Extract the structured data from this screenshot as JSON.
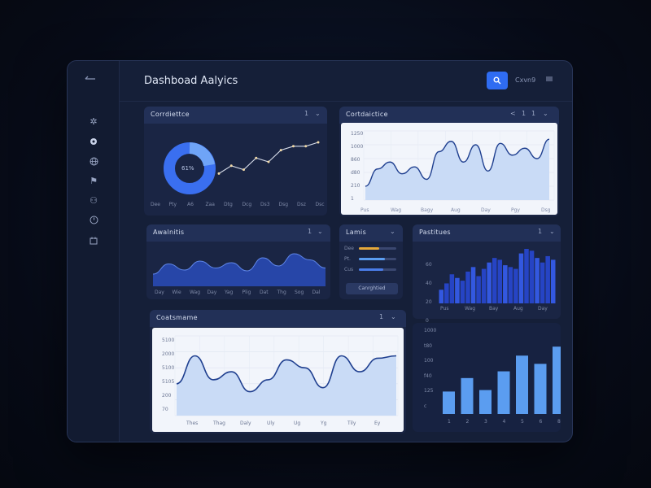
{
  "header": {
    "title": "Dashboad Aalyics",
    "user_label": "Cxvn9",
    "search_icon": "search-icon",
    "menu_icon": "menu-icon",
    "back_icon": "back-arrow-icon"
  },
  "sidebar": {
    "icons": [
      "settings-icon",
      "circle-icon",
      "globe-icon",
      "flag-icon",
      "users-icon",
      "clock-icon",
      "calendar-icon"
    ]
  },
  "cards": {
    "card1": {
      "title": "Corrdiettce",
      "donut_label": "61%",
      "ctrl_num": "1",
      "x_ticks": [
        "Dee",
        "Pty",
        "A6",
        "Zaa",
        "Dtg",
        "Dcg",
        "Ds3",
        "Dsg",
        "Dsz",
        "Dsc"
      ]
    },
    "card2": {
      "title": "Cortdaictice",
      "ctrl_a": "<",
      "ctrl_b": "1",
      "ctrl_c": "1",
      "y_ticks": [
        "1250",
        "1000",
        "860",
        "d80",
        "210",
        "1"
      ],
      "x_ticks": [
        "Pus",
        "Wag",
        "Bagy",
        "Aug",
        "Day",
        "Pgy",
        "Dsg"
      ]
    },
    "card3": {
      "title": "Awalnitis",
      "ctrl_num": "1",
      "x_ticks": [
        "Day",
        "Wie",
        "Wag",
        "Day",
        "Yag",
        "Plig",
        "Dat",
        "Thg",
        "Sog",
        "Dal"
      ]
    },
    "card4": {
      "title": "Lamis",
      "bar_labels": [
        "Dee",
        "Pt.",
        "Cus"
      ],
      "button_label": "Canrghtied"
    },
    "card5": {
      "title": "Pastitues",
      "ctrl_num": "1",
      "y_ticks": [
        "60",
        "40",
        "20",
        "0"
      ],
      "x_ticks": [
        "Pus",
        "Wag",
        "Bay",
        "Aug",
        "Day"
      ]
    },
    "card6": {
      "title": "Coatsmame",
      "ctrl_num": "1",
      "y_ticks": [
        "5100",
        "2000",
        "5100",
        "5105",
        "200",
        "70"
      ],
      "x_ticks": [
        "Thes",
        "Thag",
        "Daly",
        "Uly",
        "Ug",
        "Yg",
        "Tily",
        "Ey"
      ]
    },
    "card7": {
      "y_ticks": [
        "1000",
        "t80",
        "100",
        "f40",
        "125",
        "c"
      ],
      "x_ticks": [
        "1",
        "2",
        "3",
        "4",
        "5",
        "6",
        "8"
      ]
    }
  },
  "colors": {
    "accent": "#2f6cf2",
    "bar_blue": "#2d4fd8",
    "bar_light": "#5b9df0",
    "line_dark": "#1f3f8f",
    "orange": "#e6a93a"
  },
  "chart_data": [
    {
      "type": "line",
      "name": "card1-line",
      "values": [
        2,
        4,
        3,
        6,
        5,
        8,
        9,
        9,
        10
      ]
    },
    {
      "type": "area",
      "name": "card2-area",
      "values": [
        20,
        45,
        55,
        38,
        48,
        30,
        70,
        85,
        55,
        80,
        42,
        82,
        65,
        75,
        60,
        88
      ]
    },
    {
      "type": "area",
      "name": "card3-area",
      "values": [
        30,
        55,
        40,
        62,
        45,
        58,
        38,
        70,
        50,
        80,
        65,
        45
      ]
    },
    {
      "type": "bar",
      "name": "card4-bars",
      "values": [
        0.55,
        0.7,
        0.65
      ],
      "colors": [
        "#e6a93a",
        "#5b9df0",
        "#4a7ce8"
      ]
    },
    {
      "type": "bar",
      "name": "card5-bars",
      "values": [
        15,
        22,
        32,
        28,
        25,
        35,
        40,
        30,
        38,
        45,
        50,
        48,
        42,
        40,
        38,
        55,
        60,
        58,
        50,
        45,
        52,
        48
      ]
    },
    {
      "type": "area",
      "name": "card6-area",
      "values": [
        40,
        75,
        45,
        55,
        30,
        45,
        70,
        60,
        35,
        75,
        55,
        72,
        75
      ]
    },
    {
      "type": "bar",
      "name": "card7-bars",
      "values": [
        30,
        48,
        32,
        57,
        78,
        67,
        90
      ]
    }
  ]
}
